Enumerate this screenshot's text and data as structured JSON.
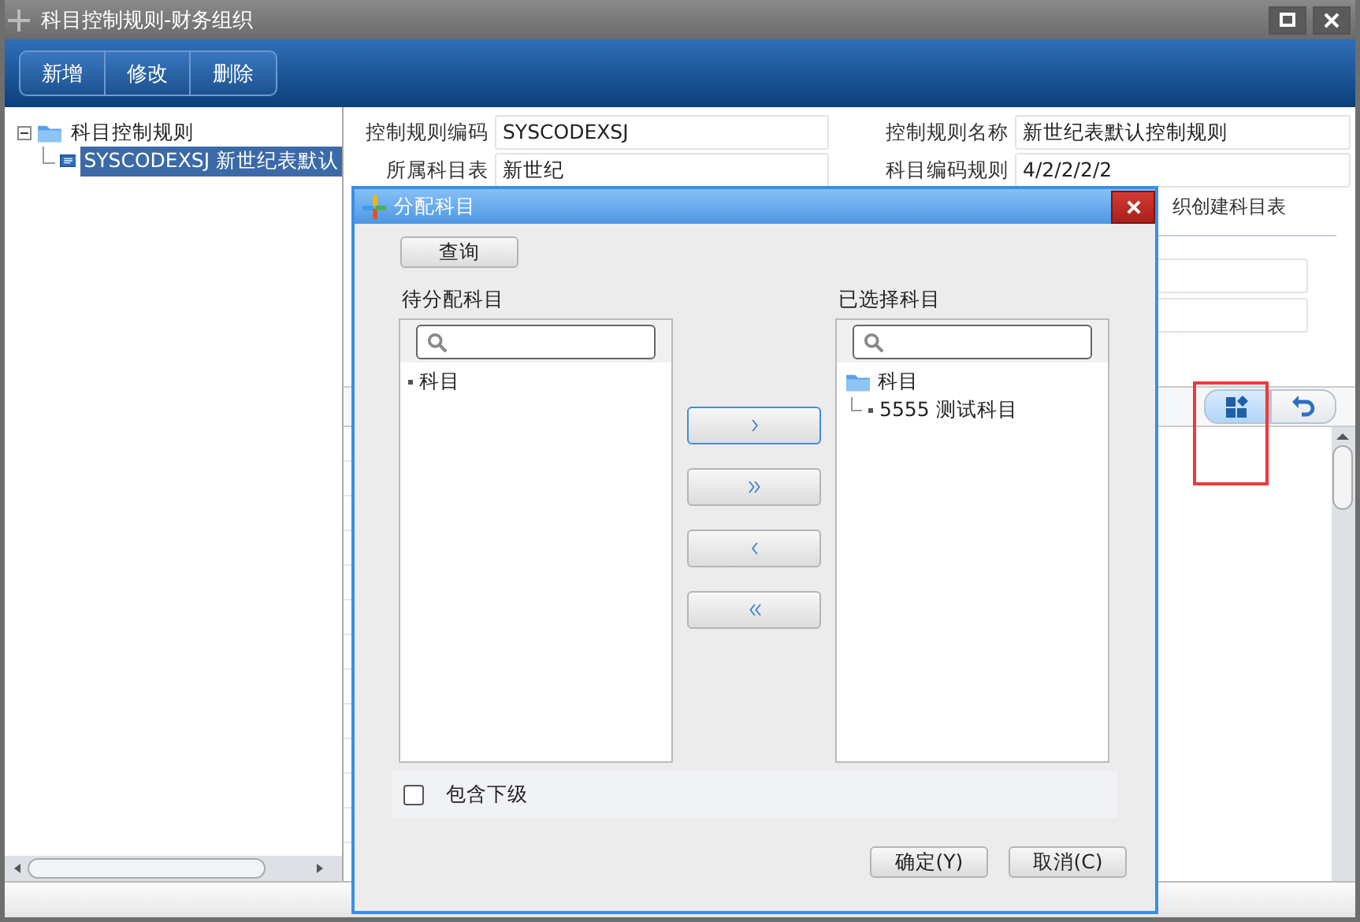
{
  "window": {
    "title": "科目控制规则-财务组织"
  },
  "toolbar": [
    {
      "label": "新增"
    },
    {
      "label": "修改"
    },
    {
      "label": "删除"
    }
  ],
  "tree": {
    "label": "科目控制规则",
    "expanded": true,
    "children": [
      {
        "label": "SYSCODEXSJ 新世纪表默认",
        "selected": true
      }
    ]
  },
  "form": {
    "fields": [
      {
        "label": "控制规则编码",
        "value": "SYSCODEXSJ"
      },
      {
        "label": "控制规则名称",
        "value": "新世纪表默认控制规则"
      },
      {
        "label": "所属科目表",
        "value": "新世纪"
      },
      {
        "label": "科目编码规则",
        "value": "4/2/2/2/2"
      }
    ],
    "note": "织创建科目表"
  },
  "grid_tools": [
    {
      "kind": "layout",
      "selected": true
    },
    {
      "kind": "undo",
      "selected": false
    }
  ],
  "dialog": {
    "title": "分配科目",
    "query_button": "查询",
    "available": {
      "title": "待分配科目",
      "items": [
        {
          "label": "科目"
        }
      ]
    },
    "chosen": {
      "title": "已选择科目",
      "tree": {
        "label": "科目",
        "children": [
          {
            "label": "5555 测试科目"
          }
        ]
      }
    },
    "transfer_buttons": [
      {
        "kind": "add-one",
        "focused": true
      },
      {
        "kind": "add-all",
        "focused": false
      },
      {
        "kind": "remove-one",
        "focused": false
      },
      {
        "kind": "remove-all",
        "focused": false
      }
    ],
    "include_children": {
      "label": "包含下级",
      "checked": false
    },
    "buttons": [
      "确定(Y)",
      "取消(C)"
    ]
  }
}
